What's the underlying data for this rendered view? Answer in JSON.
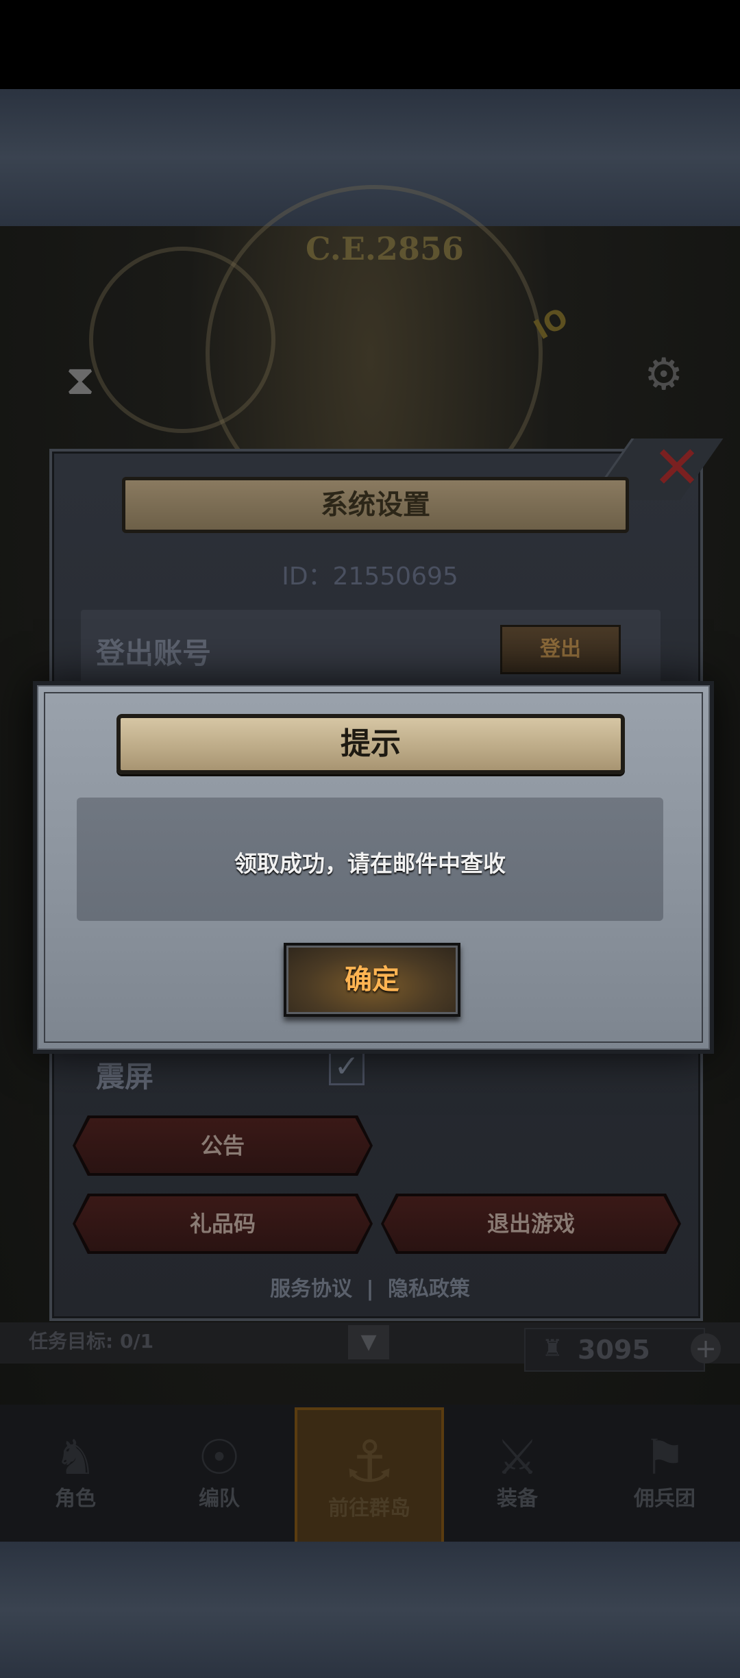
{
  "background": {
    "year_label": "C.E.2856",
    "logo_text": "IO"
  },
  "settings": {
    "title": "系统设置",
    "id_line": "ID：21550695",
    "logout_account_label": "登出账号",
    "logout_button": "登出",
    "vibration_label": "震屏",
    "vibration_checked": true,
    "announcement_button": "公告",
    "gift_code_button": "礼品码",
    "exit_game_button": "退出游戏",
    "service_agreement": "服务协议",
    "separator": "|",
    "privacy_policy": "隐私政策"
  },
  "hud": {
    "task_target": "任务目标: 0/1",
    "resource_value": "3095"
  },
  "nav": {
    "items": [
      {
        "label": "角色",
        "icon": "character-icon"
      },
      {
        "label": "编队",
        "icon": "team-icon"
      },
      {
        "label": "前往群岛",
        "icon": "islands-icon",
        "active": true
      },
      {
        "label": "装备",
        "icon": "equipment-icon"
      },
      {
        "label": "佣兵团",
        "icon": "mercenary-icon"
      }
    ]
  },
  "dialog": {
    "title": "提示",
    "message": "领取成功，请在邮件中查收",
    "confirm_button": "确定"
  },
  "colors": {
    "confirm_text": "#ffb452",
    "close_x": "#7a2020"
  }
}
